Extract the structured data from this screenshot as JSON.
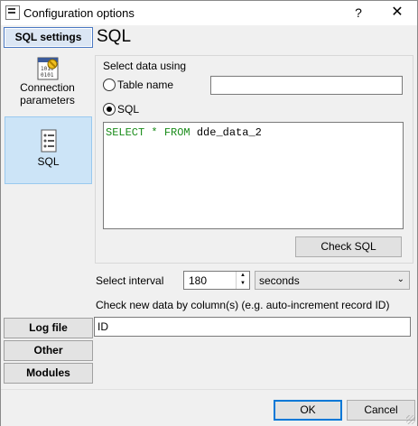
{
  "window": {
    "title": "Configuration options",
    "help_label": "?",
    "close_label": "✕"
  },
  "sidebar": {
    "top_button": "SQL settings",
    "items": [
      {
        "label_line1": "Connection",
        "label_line2": "parameters",
        "icon": "connection-parameters-icon"
      },
      {
        "label": "SQL",
        "icon": "sql-icon"
      }
    ],
    "bottom_buttons": [
      "Log file",
      "Other",
      "Modules"
    ]
  },
  "content": {
    "title": "SQL",
    "group_label": "Select data using",
    "table_name_label": "Table name",
    "table_name_value": "",
    "sql_label": "SQL",
    "sql_query": {
      "select": "SELECT",
      "star": "*",
      "from": "FROM",
      "table": "dde_data_2"
    },
    "check_sql_button": "Check SQL",
    "select_interval_label": "Select interval",
    "interval_value": "180",
    "interval_unit": "seconds",
    "check_new_data_label": "Check new data by column(s) (e.g. auto-increment record ID)",
    "check_new_data_value": "ID"
  },
  "footer": {
    "ok_label": "OK",
    "cancel_label": "Cancel"
  },
  "colors": {
    "sql_keyword": "#1a8c1a",
    "selected_item_bg": "#cce4f7",
    "ok_border": "#0078d7"
  }
}
